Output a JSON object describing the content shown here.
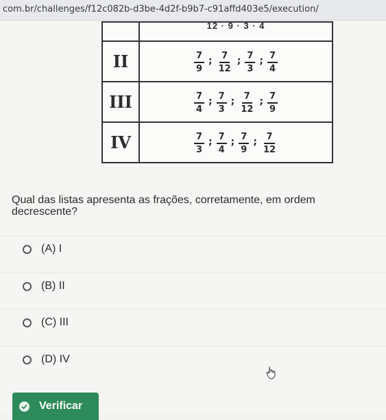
{
  "browser": {
    "url": "com.br/challenges/f12c082b-d3be-4d2f-b9b7-c91affd403e5/execution/"
  },
  "table": {
    "top_row_partial": "12 ·   9 ·   3 ·   4",
    "rows": [
      {
        "label": "II",
        "fractions": [
          {
            "num": "7",
            "den": "9"
          },
          {
            "num": "7",
            "den": "12"
          },
          {
            "num": "7",
            "den": "3"
          },
          {
            "num": "7",
            "den": "4"
          }
        ]
      },
      {
        "label": "III",
        "fractions": [
          {
            "num": "7",
            "den": "4"
          },
          {
            "num": "7",
            "den": "3"
          },
          {
            "num": "7",
            "den": "12"
          },
          {
            "num": "7",
            "den": "9"
          }
        ]
      },
      {
        "label": "IV",
        "fractions": [
          {
            "num": "7",
            "den": "3"
          },
          {
            "num": "7",
            "den": "4"
          },
          {
            "num": "7",
            "den": "9"
          },
          {
            "num": "7",
            "den": "12"
          }
        ]
      }
    ],
    "separator": ";"
  },
  "question": "Qual das listas apresenta as frações, corretamente, em ordem decrescente?",
  "options": [
    {
      "label": "(A) I"
    },
    {
      "label": "(B) II"
    },
    {
      "label": "(C) III"
    },
    {
      "label": "(D) IV"
    }
  ],
  "verify_button": {
    "label": "Verificar"
  },
  "colors": {
    "accent": "#2d8a5a"
  }
}
